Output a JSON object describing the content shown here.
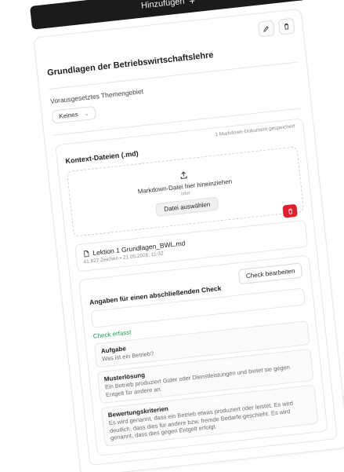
{
  "toolbar": {
    "add_label": "Hinzufügen",
    "add_icon": "plus-icon"
  },
  "card": {
    "title": "Grundlagen der Betriebswirtschaftslehre",
    "edit_icon": "pencil-icon",
    "delete_icon": "trash-icon"
  },
  "topic": {
    "label": "Vorausgesetztes Themengebiet",
    "value": "Keines",
    "chevron_icon": "chevron-down-icon"
  },
  "context": {
    "title": "Kontext-Dateien (.md)",
    "saved_count": "1 Markdown-Dokument gespeichert",
    "dropzone": {
      "upload_icon": "upload-icon",
      "drag_text": "Markdown-Datei hier hineinziehen",
      "or_text": "oder",
      "choose_button": "Datei auswählen"
    },
    "file": {
      "icon": "file-icon",
      "name": "Lektion 1 Grundlagen_BWL.md",
      "meta": "41.827 Zeichen • 21.05.2026, 11:32",
      "delete_icon": "trash-icon",
      "delete_color": "#e0202f"
    }
  },
  "check": {
    "title": "Angaben für einen abschließenden Check",
    "edit_button": "Check bearbeiten",
    "status": "Check erfasst",
    "status_color": "#1f9d55",
    "task_label": "Aufgabe",
    "task_text": "Was ist ein Betrieb?",
    "solution_label": "Musterlösung",
    "solution_text": "Ein Betrieb produziert Güter oder Dienstleistungen und bietet sie gegen Entgelt für andere an.",
    "criteria_label": "Bewertungskriterien",
    "criteria_text": "Es wird genannt, dass ein Betrieb etwas produziert oder leistet. Es wird deutlich, dass dies für andere bzw. fremde Bedarfe geschieht. Es wird genannt, dass dies gegen Entgelt erfolgt."
  }
}
